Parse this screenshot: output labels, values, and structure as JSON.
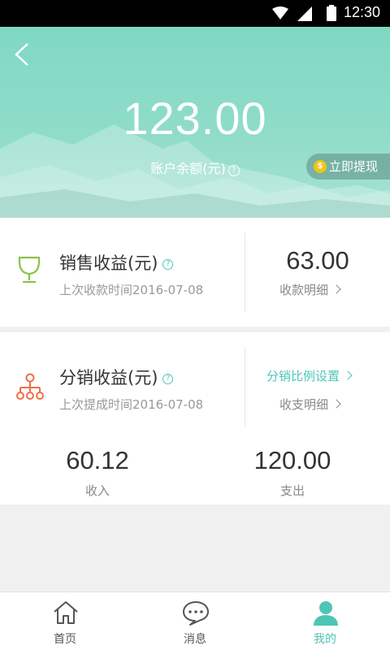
{
  "status_bar": {
    "time": "12:30"
  },
  "header": {
    "balance": "123.00",
    "balance_label": "账户余额(元)",
    "help_mark": "?",
    "withdraw_label": "立即提现"
  },
  "sales": {
    "title": "销售收益(元)",
    "help_mark": "?",
    "subtitle": "上次收款时间2016-07-08",
    "amount": "63.00",
    "detail_link": "收款明细"
  },
  "distribution": {
    "title": "分销收益(元)",
    "help_mark": "?",
    "subtitle": "上次提成时间2016-07-08",
    "ratio_link": "分销比例设置",
    "detail_link": "收支明细",
    "income_value": "60.12",
    "income_label": "收入",
    "expense_value": "120.00",
    "expense_label": "支出"
  },
  "tabbar": {
    "tabs": [
      {
        "label": "首页",
        "icon": "home-icon",
        "active": false
      },
      {
        "label": "消息",
        "icon": "message-icon",
        "active": false
      },
      {
        "label": "我的",
        "icon": "user-icon",
        "active": true
      }
    ]
  },
  "colors": {
    "accent": "#4fc5b5",
    "header_bg": "#8fdcc9",
    "trophy": "#8bc34a",
    "distribution_icon": "#f06e4a",
    "coin": "#f2c418"
  }
}
